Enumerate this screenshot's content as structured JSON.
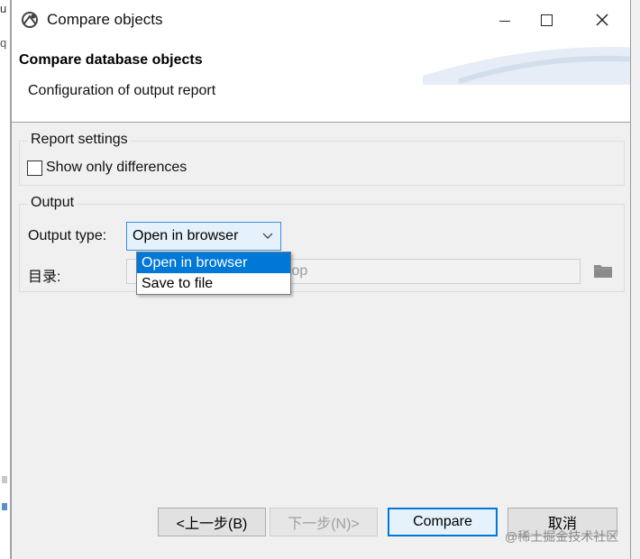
{
  "background_app": {
    "fragment1": "u",
    "fragment2": "q"
  },
  "window": {
    "title": "Compare objects"
  },
  "header": {
    "title": "Compare database objects",
    "subtitle": "Configuration of output report"
  },
  "report_settings": {
    "legend": "Report settings",
    "show_only_differences_label": "Show only differences",
    "show_only_differences_checked": false
  },
  "output": {
    "legend": "Output",
    "type_label": "Output type:",
    "type_value": "Open in browser",
    "dir_label": "目录:",
    "dir_value_visible": "ktop"
  },
  "dropdown": {
    "options": [
      "Open in browser",
      "Save to file"
    ],
    "selected": "Open in browser"
  },
  "buttons": {
    "back": "<上一步(B)",
    "next": "下一步(N)>",
    "compare": "Compare",
    "cancel": "取消"
  },
  "watermark": "@稀土掘金技术社区",
  "colors": {
    "accent": "#0078d7",
    "dropdown_selected_bg": "#0078d7",
    "focus_border": "#3a8ee6"
  },
  "icons": {
    "app": "compare-app-icon",
    "minimize": "minimize-icon",
    "maximize": "maximize-icon",
    "close": "close-icon",
    "dropdown_arrow": "chevron-down-icon",
    "folder": "folder-icon"
  }
}
